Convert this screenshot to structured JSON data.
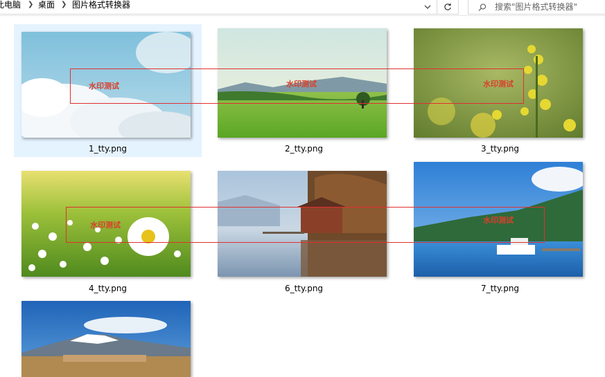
{
  "breadcrumb": {
    "items": [
      "此电脑",
      "桌面",
      "图片格式转换器"
    ]
  },
  "search": {
    "placeholder": "搜索\"图片格式转换器\""
  },
  "watermark_text": "水印测试",
  "files": [
    {
      "name": "1_tty.png"
    },
    {
      "name": "2_tty.png"
    },
    {
      "name": "3_tty.png"
    },
    {
      "name": "4_tty.png"
    },
    {
      "name": "6_tty.png"
    },
    {
      "name": "7_tty.png"
    },
    {
      "name": ""
    }
  ],
  "colors": {
    "selection": "#e5f3ff",
    "watermark": "#d8412c",
    "annotation_box": "#e03030"
  },
  "icons": [
    "chevron-right-icon",
    "chevron-down-icon",
    "refresh-icon",
    "search-icon"
  ]
}
